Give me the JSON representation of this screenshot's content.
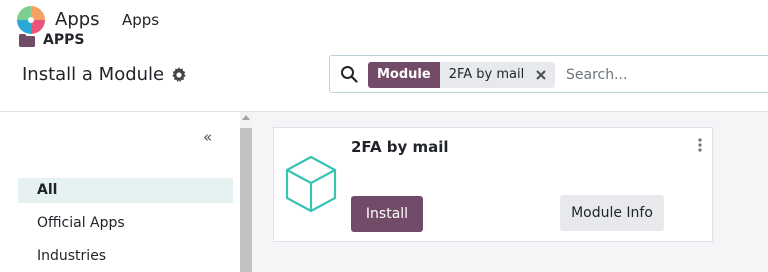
{
  "navbar": {
    "app_name": "Apps",
    "menu_apps": "Apps",
    "logo_icon": "odoo-apps-logo-icon"
  },
  "control_panel": {
    "title": "Install a Module",
    "settings_icon": "gear-icon"
  },
  "search": {
    "facet_label": "Module",
    "facet_value": "2FA by mail",
    "placeholder": "Search...",
    "value": ""
  },
  "sidebar": {
    "collapse_glyph": "«",
    "category": "APPS",
    "items": [
      {
        "label": "All",
        "active": true
      },
      {
        "label": "Official Apps",
        "active": false
      },
      {
        "label": "Industries",
        "active": false
      }
    ]
  },
  "module_card": {
    "title": "2FA by mail",
    "install_label": "Install",
    "info_label": "Module Info",
    "icon": "cube-icon"
  },
  "colors": {
    "primary": "#714b67",
    "active_bg": "#e6f1f2",
    "cube": "#38c4b0"
  }
}
